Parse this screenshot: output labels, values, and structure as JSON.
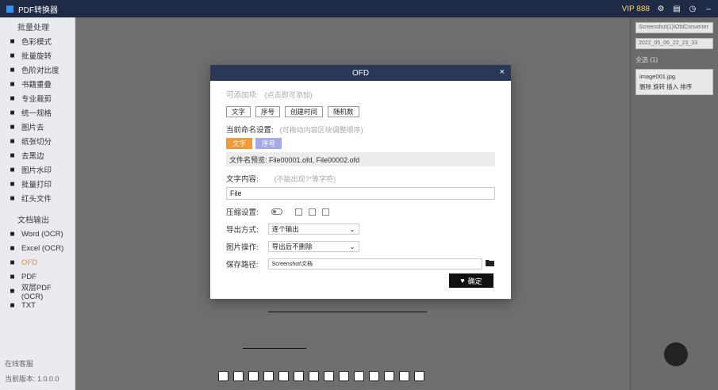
{
  "titlebar": {
    "app_name": "PDF转换器",
    "right_text": "VIP 888"
  },
  "sidebar": {
    "section1": "批量处理",
    "items1": [
      {
        "label": "色彩模式",
        "icon": "color-icon"
      },
      {
        "label": "批量旋转",
        "icon": "rotate-icon"
      },
      {
        "label": "色阶对比度",
        "icon": "contrast-icon"
      },
      {
        "label": "书籍重叠",
        "icon": "book-icon"
      },
      {
        "label": "专业裁剪",
        "icon": "crop-icon"
      },
      {
        "label": "统一规格",
        "icon": "resize-icon"
      },
      {
        "label": "图片去",
        "icon": "image-icon"
      },
      {
        "label": "纸张切分",
        "icon": "split-icon"
      },
      {
        "label": "去黑边",
        "icon": "border-icon"
      },
      {
        "label": "图片水印",
        "icon": "watermark-icon"
      },
      {
        "label": "批量打印",
        "icon": "print-icon"
      },
      {
        "label": "红头文件",
        "icon": "doc-icon"
      }
    ],
    "section2": "文档输出",
    "items2": [
      {
        "label": "Word (OCR)",
        "icon": "word-icon"
      },
      {
        "label": "Excel (OCR)",
        "icon": "excel-icon"
      },
      {
        "label": "OFD",
        "icon": "ofd-icon",
        "active": true
      },
      {
        "label": "PDF",
        "icon": "pdf-icon"
      },
      {
        "label": "双层PDF (OCR)",
        "icon": "pdf2-icon"
      },
      {
        "label": "TXT",
        "icon": "txt-icon"
      }
    ],
    "bottom1": "在线客服",
    "bottom2": "当前版本: 1.0.0.0"
  },
  "rpanel": {
    "field1": "Screenshot(1)\\OfdConverter",
    "field2": "2022_05_06_22_23_33",
    "checkall": "全选 (1)",
    "file": "image001.jpg",
    "actions": "删除  旋转  插入  排序"
  },
  "modal": {
    "title": "OFD",
    "close": "×",
    "rule_label": "可添加项:",
    "rule_hint": "(点击即可添加)",
    "rule_buttons": [
      "文字",
      "序号",
      "创建时间",
      "随机数"
    ],
    "current_label": "当前命名设置:",
    "current_hint": "(可拖动内容区块调整顺序)",
    "chips": [
      "文字",
      "序号"
    ],
    "preview": "文件名预览: File00001.ofd, File00002.ofd",
    "text_label": "文字内容:",
    "text_hint": "(不能出现?*等字符)",
    "text_value": "File",
    "compress_label": "压缩设置:",
    "export_label": "导出方式:",
    "export_value": "逐个输出",
    "image_label": "图片操作:",
    "image_value": "导出后不删除",
    "path_label": "保存路径:",
    "path_value": "Screenshot\\文档",
    "confirm": "确定"
  }
}
